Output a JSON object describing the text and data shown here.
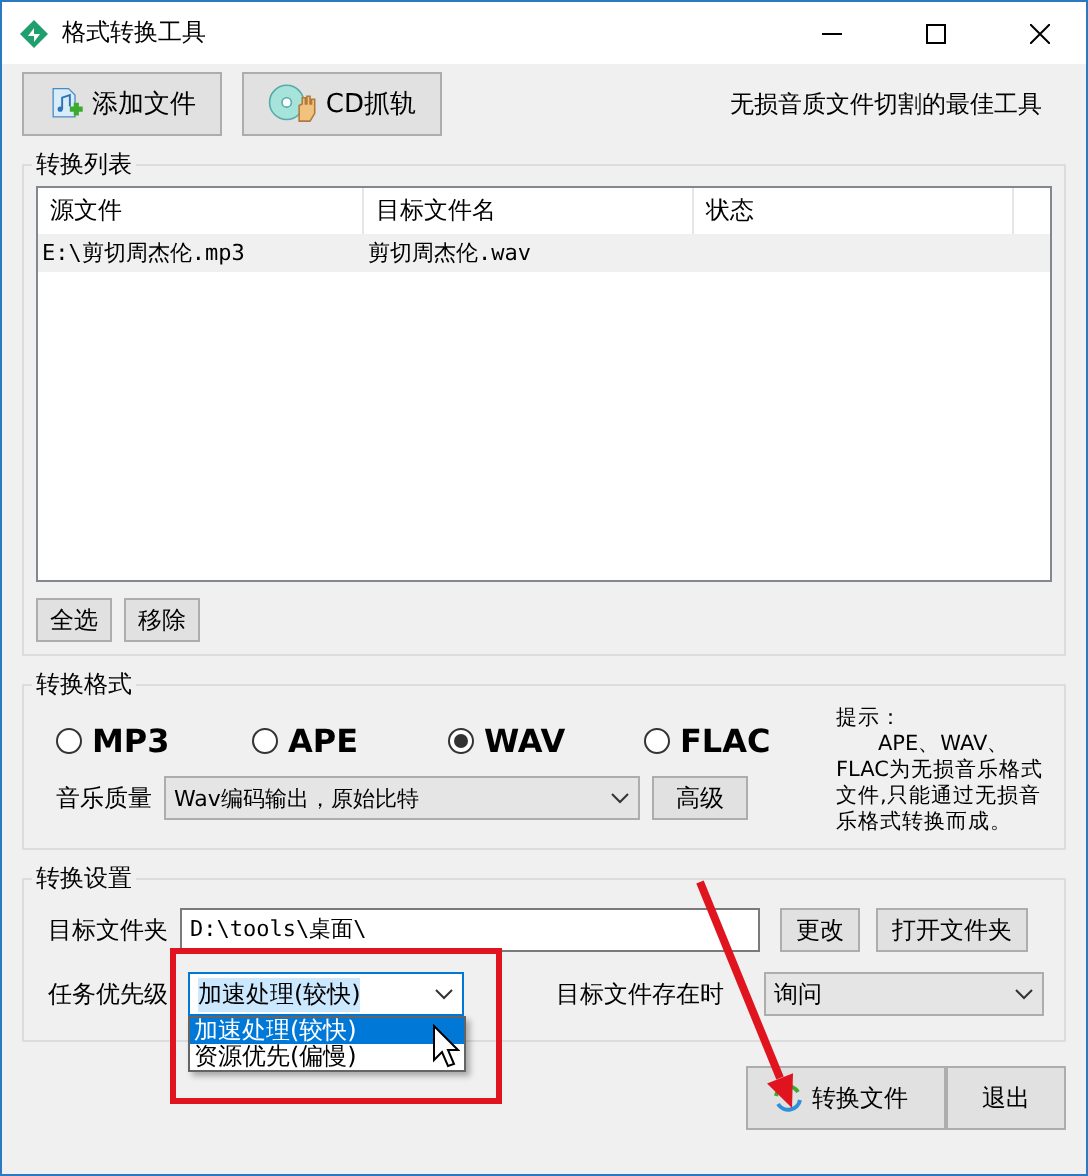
{
  "window": {
    "title": "格式转换工具"
  },
  "toolbar": {
    "buttons": [
      {
        "label": "添加文件",
        "kind": "add"
      },
      {
        "label": "CD抓轨",
        "kind": "cd"
      }
    ],
    "slogan": "无损音质文件切割的最佳工具"
  },
  "list_group": {
    "title": "转换列表",
    "columns": [
      "源文件",
      "目标文件名",
      "状态"
    ],
    "rows": [
      {
        "cells": [
          "E:\\剪切周杰伦.mp3",
          "剪切周杰伦.wav",
          ""
        ],
        "selected": true
      }
    ],
    "buttons": [
      "全选",
      "移除"
    ]
  },
  "format_group": {
    "title": "转换格式",
    "formats": [
      {
        "label": "MP3",
        "selected": false
      },
      {
        "label": "APE",
        "selected": false
      },
      {
        "label": "WAV",
        "selected": true
      },
      {
        "label": "FLAC",
        "selected": false
      }
    ],
    "quality_label": "音乐质量",
    "quality_value": "Wav编码输出，原始比特",
    "advanced_button": "高级",
    "hint_title": "提示：",
    "hint_text": "APE、WAV、FLAC为无损音乐格式文件,只能通过无损音乐格式转换而成。"
  },
  "settings_group": {
    "title": "转换设置",
    "folder_label": "目标文件夹",
    "folder_value": "D:\\tools\\桌面\\",
    "change_button": "更改",
    "open_button": "打开文件夹",
    "priority_label": "任务优先级",
    "priority_value": "加速处理(较快)",
    "priority_options": [
      {
        "label": "加速处理(较快)",
        "selected": true
      },
      {
        "label": "资源优先(偏慢)",
        "selected": false
      }
    ],
    "exists_label": "目标文件存在时",
    "exists_value": "询问"
  },
  "footer": {
    "convert_button": "转换文件",
    "exit_button": "退出"
  }
}
